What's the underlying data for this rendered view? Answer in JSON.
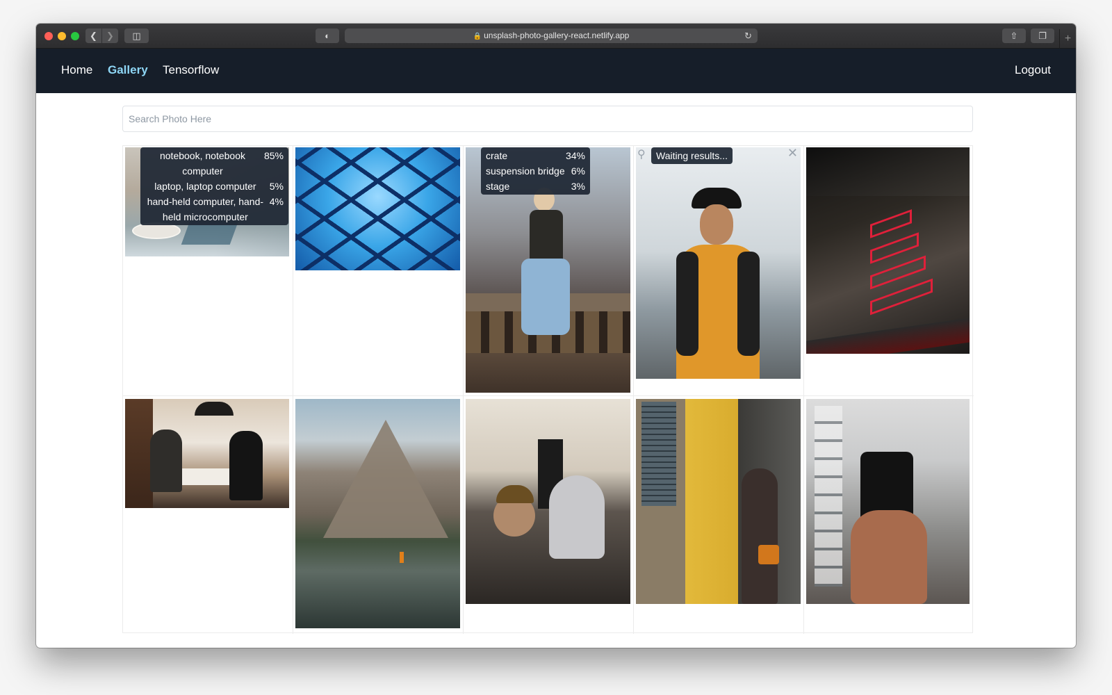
{
  "browser": {
    "url": "unsplash-photo-gallery-react.netlify.app"
  },
  "nav": {
    "home": "Home",
    "gallery": "Gallery",
    "tensorflow": "Tensorflow",
    "logout": "Logout"
  },
  "search": {
    "placeholder": "Search Photo Here"
  },
  "predictions": {
    "photo1": [
      {
        "label": "notebook, notebook computer",
        "pct": "85%"
      },
      {
        "label": "laptop, laptop computer",
        "pct": "5%"
      },
      {
        "label": "hand-held computer, hand-held microcomputer",
        "pct": "4%"
      }
    ],
    "photo3": [
      {
        "label": "crate",
        "pct": "34%"
      },
      {
        "label": "suspension bridge",
        "pct": "6%"
      },
      {
        "label": "stage",
        "pct": "3%"
      }
    ],
    "photo4_status": "Waiting results..."
  },
  "colors": {
    "navbar_bg": "#161e29",
    "active_link": "#8ed6f5",
    "tooltip_bg": "#1d2633"
  }
}
